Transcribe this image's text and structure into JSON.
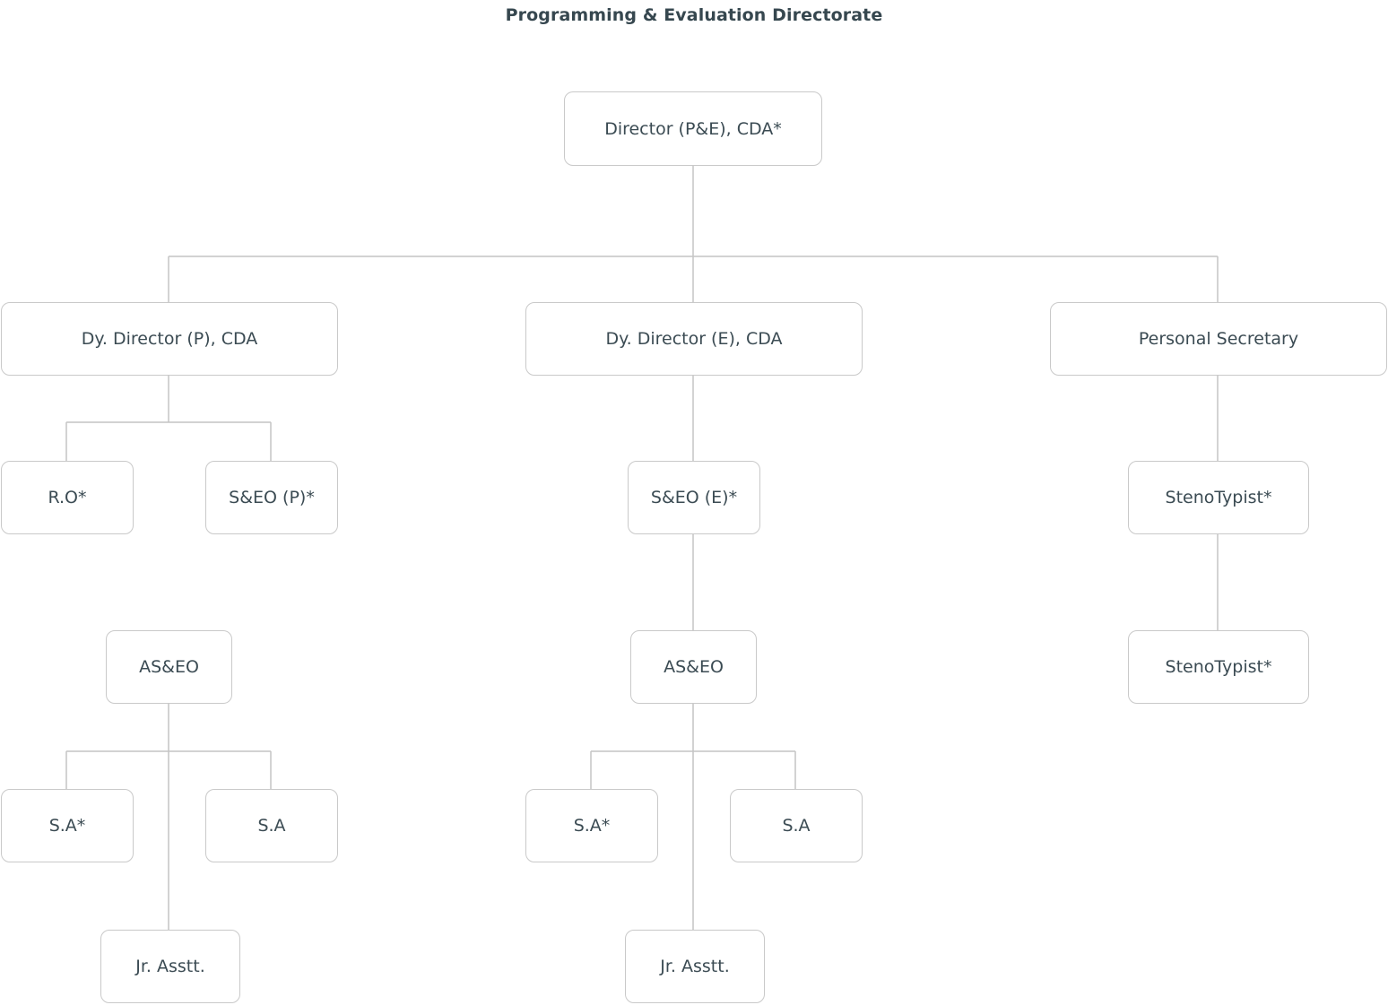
{
  "title": "Programming & Evaluation Directorate",
  "nodes": {
    "director": "Director (P&E),  CDA*",
    "dy_director_p": "Dy. Director (P), CDA",
    "dy_director_e": "Dy. Director (E), CDA",
    "personal_secretary": "Personal Secretary",
    "ro": "R.O*",
    "seo_p": "S&EO (P)*",
    "seo_e": "S&EO (E)*",
    "stenotypist_1": "StenoTypist*",
    "stenotypist_2": "StenoTypist*",
    "aseo_p": "AS&EO",
    "aseo_e": "AS&EO",
    "sa_star_p": "S.A*",
    "sa_p": "S.A",
    "sa_star_e": "S.A*",
    "sa_e": "S.A",
    "jr_asstt_p": "Jr. Asstt.",
    "jr_asstt_e": "Jr. Asstt."
  }
}
